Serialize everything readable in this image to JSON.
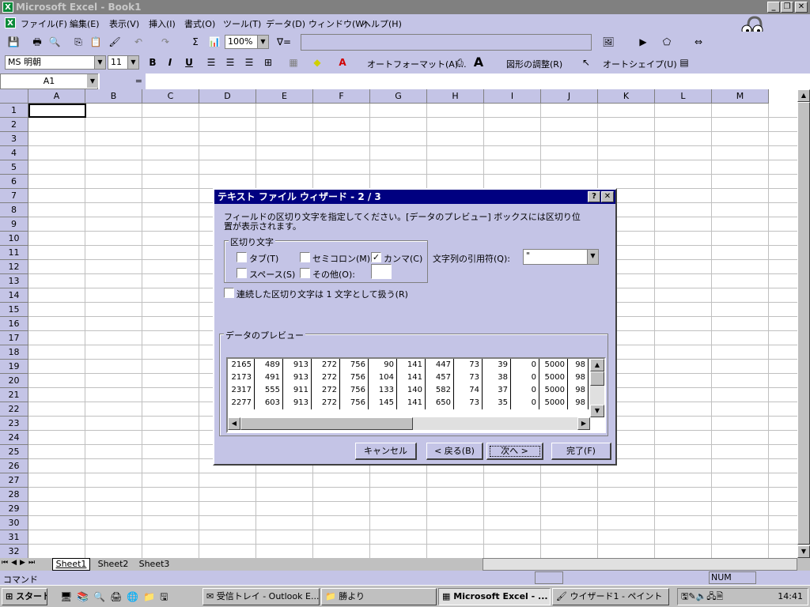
{
  "window": {
    "title": "Microsoft Excel - Book1",
    "app_icon": "X",
    "min": "_",
    "restore": "❐",
    "close": "✕"
  },
  "menu": [
    "ファイル(F)",
    "編集(E)",
    "表示(V)",
    "挿入(I)",
    "書式(O)",
    "ツール(T)",
    "データ(D)",
    "ウィンドウ(W)",
    "ヘルプ(H)"
  ],
  "toolbar1": {
    "zoom": "100%",
    "sigma": "Σ",
    "filter": "∇="
  },
  "toolbar2": {
    "font": "MS 明朝",
    "size": "11",
    "bold": "B",
    "italic": "I",
    "underline": "U",
    "autoformat": "オートフォーマット(A)...",
    "adjust": "図形の調整(R)",
    "autoshape": "オートシェイプ(U)"
  },
  "formulabar": {
    "cellref": "A1",
    "equals": "="
  },
  "columns": [
    "A",
    "B",
    "C",
    "D",
    "E",
    "F",
    "G",
    "H",
    "I",
    "J",
    "K",
    "L",
    "M"
  ],
  "rows": [
    "1",
    "2",
    "3",
    "4",
    "5",
    "6",
    "7",
    "8",
    "9",
    "10",
    "11",
    "12",
    "13",
    "14",
    "15",
    "16",
    "17",
    "18",
    "19",
    "20",
    "21",
    "22",
    "23",
    "24",
    "25",
    "26",
    "27",
    "28",
    "29",
    "30",
    "31",
    "32"
  ],
  "sheets": [
    "Sheet1",
    "Sheet2",
    "Sheet3"
  ],
  "statusbar": {
    "left": "コマンド",
    "num": "NUM"
  },
  "dialog": {
    "title": "テキスト ファイル ウィザード - 2 / 3",
    "help": "?",
    "close": "✕",
    "instruction_line1": "フィールドの区切り文字を指定してください。[データのプレビュー] ボックスには区切り位",
    "instruction_line2": "置が表示されます。",
    "delimiters_group": "区切り文字",
    "tab": "タブ(T)",
    "semicolon": "セミコロン(M)",
    "comma": "カンマ(C)",
    "space": "スペース(S)",
    "other": "その他(O):",
    "comma_checked": "✓",
    "quote_label": "文字列の引用符(Q):",
    "quote_value": "\"",
    "consecutive": "連続した区切り文字は 1 文字として扱う(R)",
    "preview_group": "データのプレビュー",
    "preview_rows": [
      [
        "2165",
        "489",
        "913",
        "272",
        "756",
        "90",
        "141",
        "447",
        "73",
        "39",
        "0",
        "5000",
        "98"
      ],
      [
        "2173",
        "491",
        "913",
        "272",
        "756",
        "104",
        "141",
        "457",
        "73",
        "38",
        "0",
        "5000",
        "98"
      ],
      [
        "2317",
        "555",
        "911",
        "272",
        "756",
        "133",
        "140",
        "582",
        "74",
        "37",
        "0",
        "5000",
        "98"
      ],
      [
        "2277",
        "603",
        "913",
        "272",
        "756",
        "145",
        "141",
        "650",
        "73",
        "35",
        "0",
        "5000",
        "98"
      ]
    ],
    "cancel": "キャンセル",
    "back": "< 戻る(B)",
    "next": "次へ >",
    "finish": "完了(F)"
  },
  "taskbar": {
    "start": "スタート",
    "tasks": [
      "受信トレイ - Outlook E...",
      "勝より",
      "Microsoft Excel - ...",
      "ウイザード1 - ペイント"
    ],
    "clock": "14:41"
  }
}
